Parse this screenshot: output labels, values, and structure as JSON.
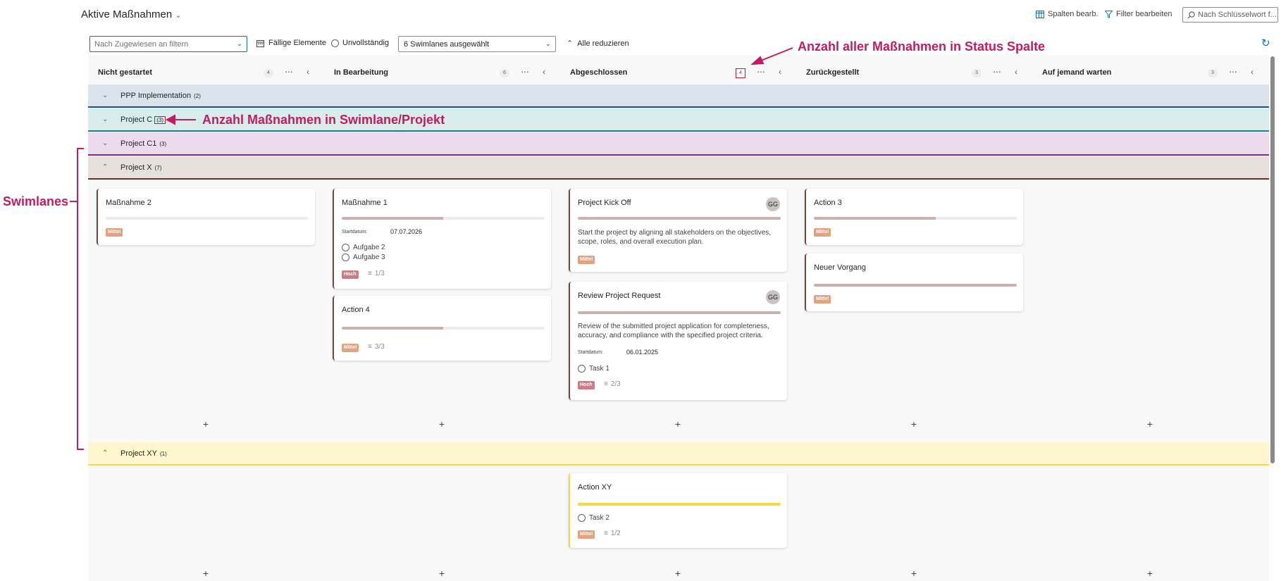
{
  "header": {
    "title": "Aktive Maßnahmen",
    "edit_columns": "Spalten bearb.",
    "edit_filter": "Filter bearbeiten",
    "search_placeholder": "Nach Schlüsselwort f..."
  },
  "filters": {
    "assign_placeholder": "Nach Zugewiesen an filtern",
    "due_items": "Fällige Elemente",
    "incomplete": "Unvollständig",
    "swimlanes_selected": "6 Swimlanes ausgewählt",
    "collapse_all": "Alle reduzieren"
  },
  "columns": [
    {
      "name": "Nicht gestartet",
      "count": "4"
    },
    {
      "name": "In Bearbeitung",
      "count": "6"
    },
    {
      "name": "Abgeschlossen",
      "count": "4"
    },
    {
      "name": "Zurückgestellt",
      "count": "3"
    },
    {
      "name": "Auf jemand warten",
      "count": "3"
    }
  ],
  "lanes": [
    {
      "name": "PPP Implementation",
      "count": "(2)",
      "color": "#dbe4ec",
      "line": "#1f4e79"
    },
    {
      "name": "Project C",
      "count": "(3)",
      "color": "#d9ecec",
      "line": "#1f7a8c"
    },
    {
      "name": "Project C1",
      "count": "(3)",
      "color": "#eddbed",
      "line": "#7a2a8c"
    },
    {
      "name": "Project X",
      "count": "(7)",
      "color": "#e6dfdc",
      "line": "#6b2e22"
    },
    {
      "name": "Project XY",
      "count": "(1)",
      "color": "#fdf6cf",
      "line": "#f2d842"
    }
  ],
  "cards": {
    "massnahme2": {
      "title": "Maßnahme 2",
      "priority": "Mittel",
      "progress": 0
    },
    "massnahme1": {
      "title": "Maßnahme 1",
      "start_label": "Startdatum:",
      "start": "07.07.2026",
      "tasks": [
        "Aufgabe 2",
        "Aufgabe 3"
      ],
      "priority": "Hoch",
      "checklist": "1/3",
      "progress": 0.5
    },
    "action4": {
      "title": "Action 4",
      "priority": "Mittel",
      "checklist": "3/3",
      "progress": 0.5
    },
    "kickoff": {
      "title": "Project Kick Off",
      "avatar": "GG",
      "description": "Start the project by aligning all stakeholders on the objectives, scope, roles, and overall execution plan.",
      "priority": "Mittel",
      "progress": 1
    },
    "review": {
      "title": "Review Project Request",
      "avatar": "GG",
      "description": "Review of the submitted project application for completeness, accuracy, and compliance with the specified project criteria.",
      "start_label": "Startdatum:",
      "start": "06.01.2025",
      "tasks": [
        "Task 1"
      ],
      "priority": "Hoch",
      "checklist": "2/3",
      "progress": 1
    },
    "action3": {
      "title": "Action 3",
      "priority": "Mittel",
      "progress": 0.6
    },
    "neuer": {
      "title": "Neuer Vorgang",
      "priority": "Mittel",
      "progress": 1
    },
    "actionxy": {
      "title": "Action XY",
      "tasks": [
        "Task 2"
      ],
      "priority": "Mittel",
      "checklist": "1/2",
      "progress": 1
    }
  },
  "add_symbol": "+",
  "annotations": {
    "status_count": "Anzahl aller Maßnahmen in Status Spalte",
    "lane_count": "Anzahl Maßnahmen in Swimlane/Projekt",
    "swimlanes": "Swimlanes"
  },
  "colors": {
    "annotation": "#c01d60",
    "accent": "#0f6cbd"
  }
}
